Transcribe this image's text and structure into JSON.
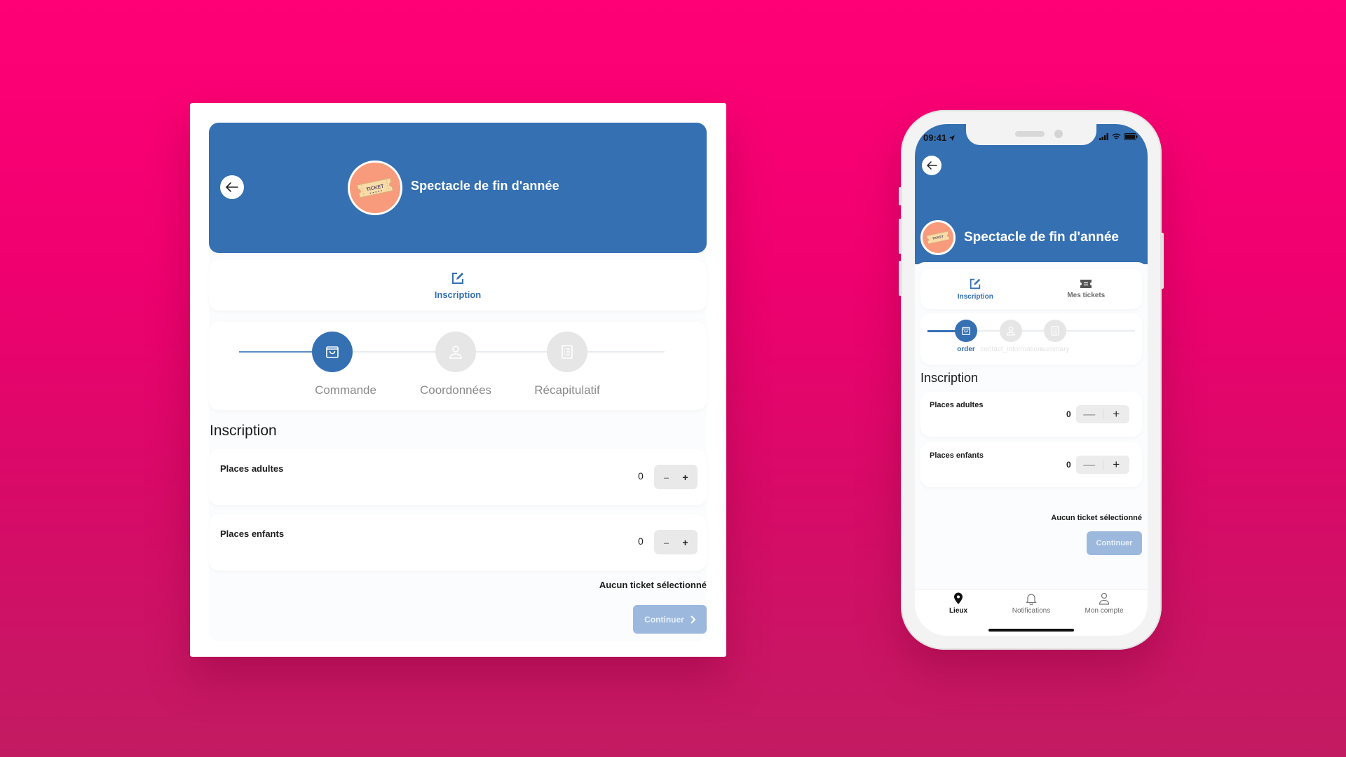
{
  "colors": {
    "background_top": "#ff0077",
    "background_bottom": "#c21b62",
    "primary": "#3570b3",
    "disabled_button": "#9cb9dd",
    "avatar": "#f89a7c",
    "inactive_step": "#e6e6e6"
  },
  "event": {
    "title": "Spectacle de fin d'année",
    "avatar_icon": "ticket-icon",
    "avatar_text": "TICKET"
  },
  "tablet": {
    "back_icon": "arrow-left-icon",
    "tabs": [
      {
        "label": "Inscription",
        "icon": "edit-icon",
        "active": true
      }
    ],
    "steps": [
      {
        "label": "Commande",
        "icon": "shopping-bag-icon",
        "active": true
      },
      {
        "label": "Coordonnées",
        "icon": "user-icon",
        "active": false
      },
      {
        "label": "Récapitulatif",
        "icon": "checklist-icon",
        "active": false
      }
    ],
    "section_title": "Inscription",
    "rows": [
      {
        "label": "Places adultes",
        "quantity": "0",
        "minus": "–",
        "plus": "+"
      },
      {
        "label": "Places enfants",
        "quantity": "0",
        "minus": "–",
        "plus": "+"
      }
    ],
    "empty_message": "Aucun ticket sélectionné",
    "continue_label": "Continuer",
    "continue_icon": "chevron-right-icon"
  },
  "phone": {
    "status_bar": {
      "time": "09:41",
      "location_icon": "location-arrow-icon",
      "signal_icon": "signal-icon",
      "wifi_icon": "wifi-icon",
      "battery_icon": "battery-icon"
    },
    "back_icon": "arrow-left-icon",
    "tabs": [
      {
        "label": "Inscription",
        "icon": "edit-icon",
        "active": true
      },
      {
        "label": "Mes tickets",
        "icon": "ticket-icon",
        "active": false
      }
    ],
    "steps": [
      {
        "label": "order",
        "icon": "shopping-bag-icon",
        "active": true
      },
      {
        "label": "contact_information",
        "icon": "user-icon",
        "active": false
      },
      {
        "label": "summary",
        "icon": "checklist-icon",
        "active": false
      }
    ],
    "section_title": "Inscription",
    "rows": [
      {
        "label": "Places adultes",
        "quantity": "0",
        "minus": "—",
        "plus": "+"
      },
      {
        "label": "Places enfants",
        "quantity": "0",
        "minus": "—",
        "plus": "+"
      }
    ],
    "empty_message": "Aucun ticket sélectionné",
    "continue_label": "Continuer",
    "bottom_nav": [
      {
        "label": "Lieux",
        "icon": "map-pin-icon",
        "active": true
      },
      {
        "label": "Notifications",
        "icon": "bell-icon",
        "active": false
      },
      {
        "label": "Mon compte",
        "icon": "user-icon",
        "active": false
      }
    ]
  }
}
